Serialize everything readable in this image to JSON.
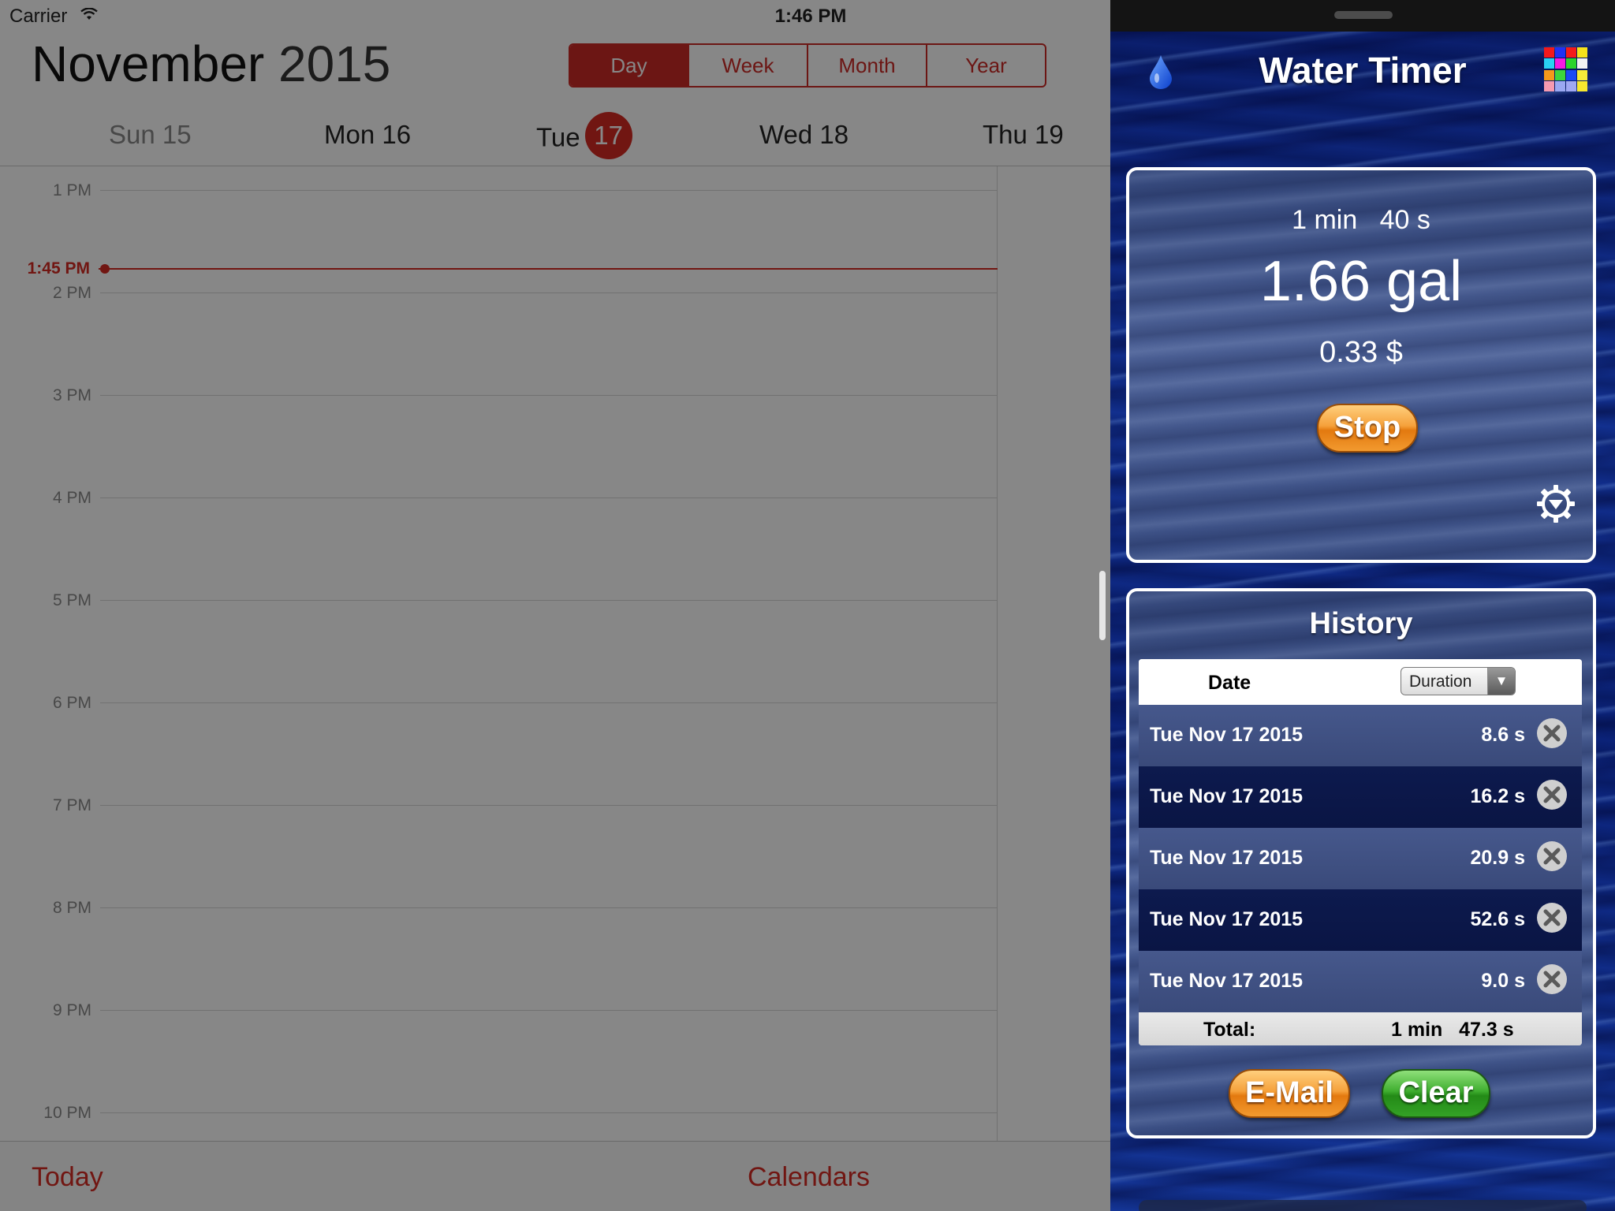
{
  "status_bar": {
    "carrier": "Carrier",
    "time": "1:46 PM"
  },
  "calendar": {
    "month": "November",
    "year": "2015",
    "view_tabs": [
      "Day",
      "Week",
      "Month",
      "Year"
    ],
    "selected_tab": "Day",
    "days": [
      {
        "name": "Sun 15"
      },
      {
        "name": "Mon 16"
      },
      {
        "name": "Tue",
        "badge": "17"
      },
      {
        "name": "Wed 18"
      },
      {
        "name": "Thu 19"
      }
    ],
    "hours": [
      "1 PM",
      "2 PM",
      "3 PM",
      "4 PM",
      "5 PM",
      "6 PM",
      "7 PM",
      "8 PM",
      "9 PM",
      "10 PM"
    ],
    "now_label": "1:45 PM",
    "footer": {
      "today": "Today",
      "calendars": "Calendars"
    },
    "accent_color": "#d52b23"
  },
  "water_timer": {
    "title": "Water Timer",
    "timer": {
      "elapsed": "1 min   40 s",
      "volume": "1.66 gal",
      "cost": "0.33 $",
      "stop_label": "Stop"
    },
    "history": {
      "title": "History",
      "col_date": "Date",
      "sort_select": "Duration",
      "rows": [
        {
          "date": "Tue Nov 17 2015",
          "duration": "8.6 s"
        },
        {
          "date": "Tue Nov 17 2015",
          "duration": "16.2 s"
        },
        {
          "date": "Tue Nov 17 2015",
          "duration": "20.9 s"
        },
        {
          "date": "Tue Nov 17 2015",
          "duration": "52.6 s"
        },
        {
          "date": "Tue Nov 17 2015",
          "duration": "9.0 s"
        }
      ],
      "total_label": "Total:",
      "total_value": "1 min   47.3 s",
      "email_label": "E-Mail",
      "clear_label": "Clear"
    },
    "icons": [
      "water-drop-icon",
      "color-grid-icon",
      "settings-gear-icon",
      "delete-x-icon"
    ]
  }
}
